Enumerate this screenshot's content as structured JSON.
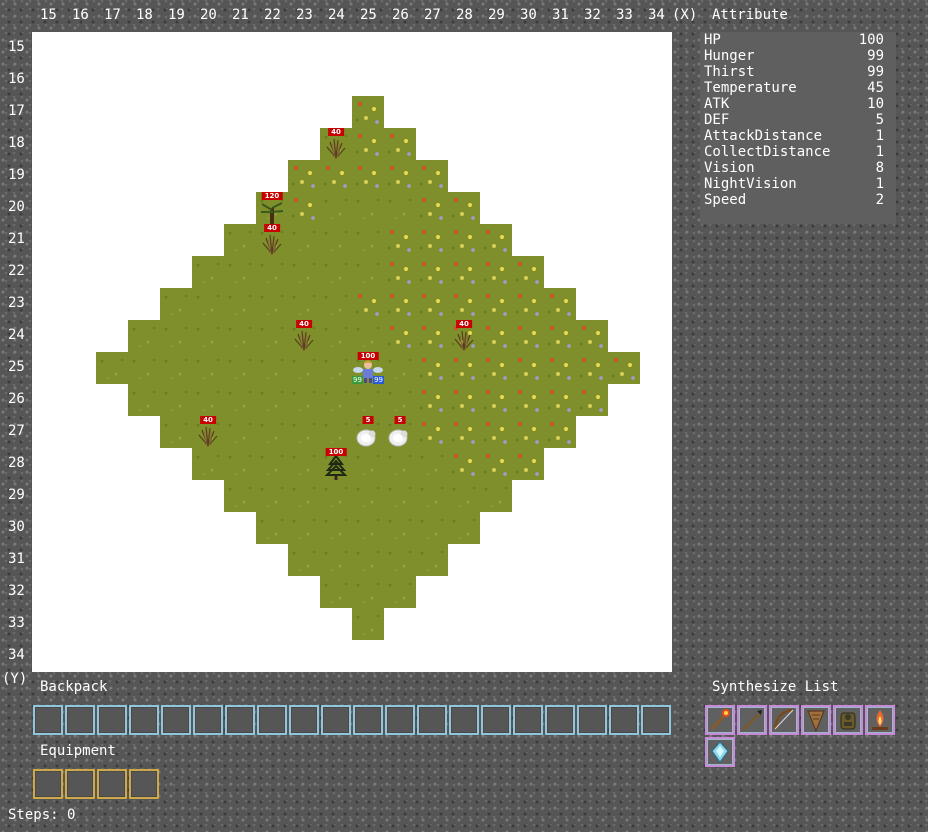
{
  "x_axis_labels": [
    "15",
    "16",
    "17",
    "18",
    "19",
    "20",
    "21",
    "22",
    "23",
    "24",
    "25",
    "26",
    "27",
    "28",
    "29",
    "30",
    "31",
    "32",
    "33",
    "34"
  ],
  "x_axis_suffix": "(X)",
  "y_axis_labels": [
    "15",
    "16",
    "17",
    "18",
    "19",
    "20",
    "21",
    "22",
    "23",
    "24",
    "25",
    "26",
    "27",
    "28",
    "29",
    "30",
    "31",
    "32",
    "33",
    "34"
  ],
  "y_axis_suffix": "(Y)",
  "attribute_title": "Attribute",
  "attributes": [
    {
      "name": "HP",
      "value": "100"
    },
    {
      "name": "Hunger",
      "value": "99"
    },
    {
      "name": "Thirst",
      "value": "99"
    },
    {
      "name": "Temperature",
      "value": "45"
    },
    {
      "name": "ATK",
      "value": "10"
    },
    {
      "name": "DEF",
      "value": "5"
    },
    {
      "name": "AttackDistance",
      "value": "1"
    },
    {
      "name": "CollectDistance",
      "value": "1"
    },
    {
      "name": "Vision",
      "value": "8"
    },
    {
      "name": "NightVision",
      "value": "1"
    },
    {
      "name": "Speed",
      "value": "2"
    }
  ],
  "backpack_title": "Backpack",
  "equipment_title": "Equipment",
  "synthesize_title": "Synthesize List",
  "steps_text": "Steps: 0",
  "map_entities": [
    {
      "kind": "bush",
      "hp": "40",
      "col": 24,
      "row": 18
    },
    {
      "kind": "tree",
      "hp": "120",
      "col": 22,
      "row": 20
    },
    {
      "kind": "bush",
      "hp": "40",
      "col": 22,
      "row": 21
    },
    {
      "kind": "bush",
      "hp": "40",
      "col": 23,
      "row": 24
    },
    {
      "kind": "bush",
      "hp": "40",
      "col": 28,
      "row": 24
    },
    {
      "kind": "player",
      "hp": "100",
      "col": 25,
      "row": 25,
      "left_stat": "99",
      "right_stat": "99"
    },
    {
      "kind": "bush",
      "hp": "40",
      "col": 20,
      "row": 27
    },
    {
      "kind": "sheep",
      "hp": "5",
      "col": 25,
      "row": 27
    },
    {
      "kind": "sheep",
      "hp": "5",
      "col": 26,
      "row": 27
    },
    {
      "kind": "pine",
      "hp": "100",
      "col": 24,
      "row": 28
    }
  ],
  "synthesize_items": [
    "torch-icon",
    "spear-icon",
    "bow-icon",
    "shield-icon",
    "armor-icon",
    "campfire-icon",
    "crystal-icon"
  ],
  "colors": {
    "grass": "#7e8f2c",
    "hp_label": "#c80000",
    "backpack_slot_border": "#8fc6dc",
    "equipment_slot_border": "#cfa84a",
    "synth_slot_border": "#c78ad8"
  }
}
